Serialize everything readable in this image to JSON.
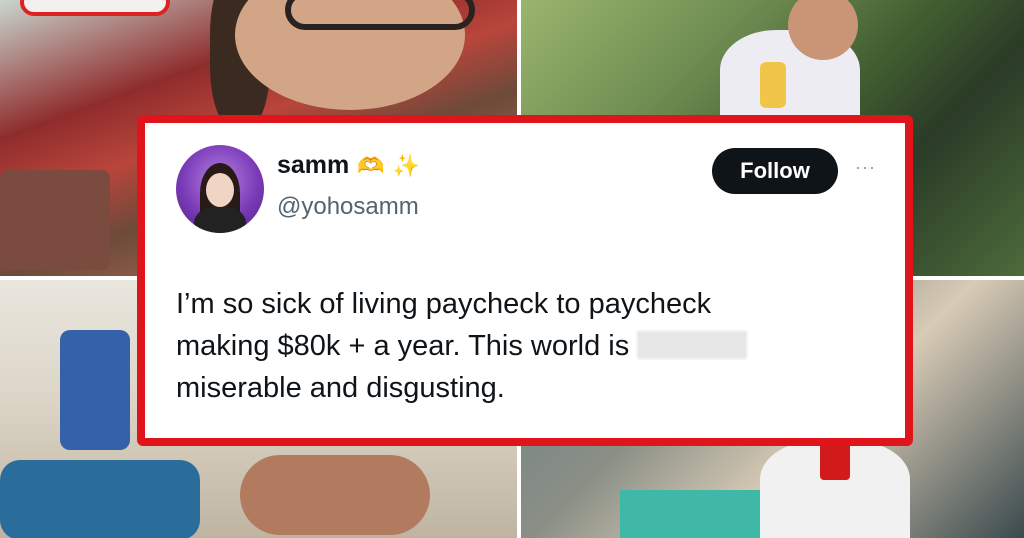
{
  "tweet": {
    "display_name": "samm",
    "emoji_1": "🫶",
    "emoji_2": "✨",
    "handle": "@yohosamm",
    "follow_label": "Follow",
    "more_label": "···",
    "text_line_1": "I’m so sick of living paycheck to paycheck",
    "text_line_2_before": "making $80k + a year. This world is ",
    "text_line_3": "miserable and disgusting."
  },
  "colors": {
    "card_border": "#e0141b",
    "follow_bg": "#0f1419",
    "handle_text": "#536471"
  },
  "icons": {
    "more": "more-horizontal-icon",
    "avatar": "profile-avatar"
  }
}
